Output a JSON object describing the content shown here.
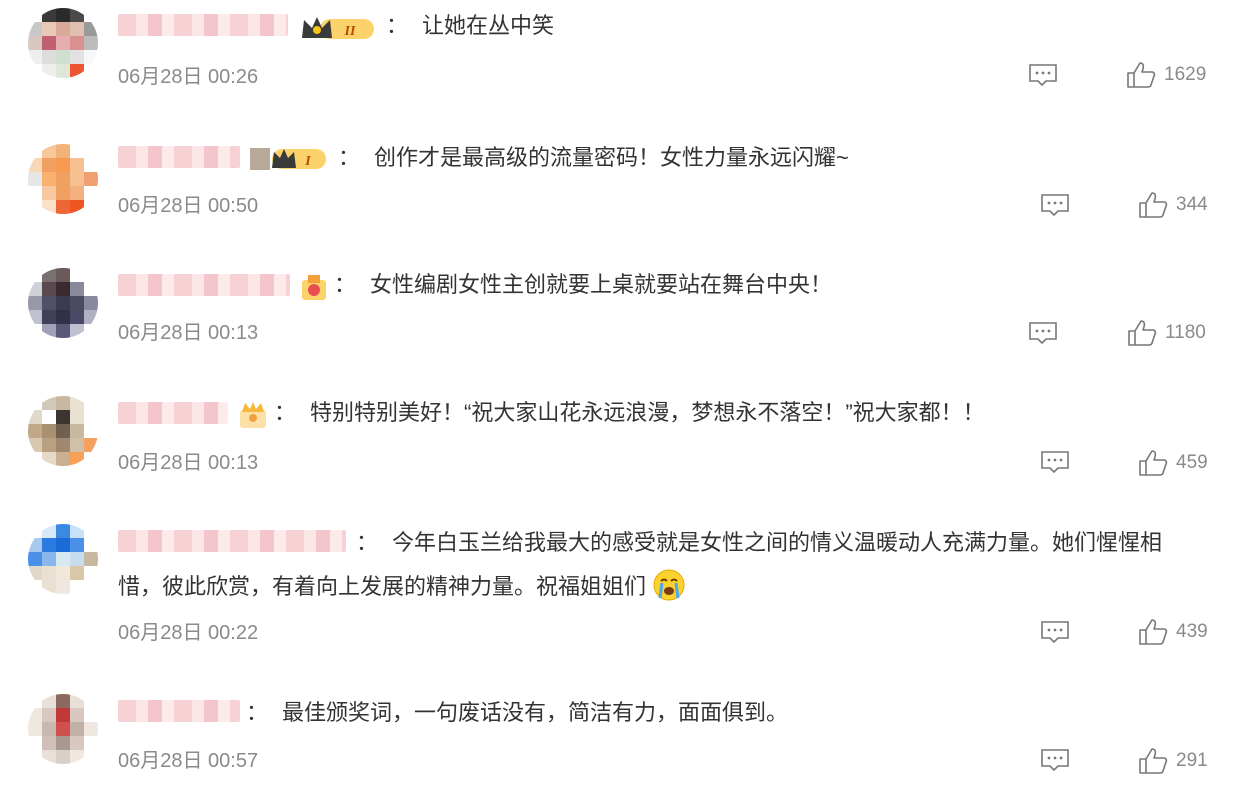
{
  "comments": [
    {
      "colon": "：",
      "text": "让她在丛中笑",
      "time": "06月28日 00:26",
      "likes": "1629"
    },
    {
      "colon": "：",
      "text": "创作才是最高级的流量密码！女性力量永远闪耀~",
      "time": "06月28日 00:50",
      "likes": "344"
    },
    {
      "colon": "：",
      "text": "女性编剧女性主创就要上桌就要站在舞台中央！",
      "time": "06月28日 00:13",
      "likes": "1180"
    },
    {
      "colon": "：",
      "text": "特别特别美好！“祝大家山花永远浪漫，梦想永不落空！”祝大家都！！",
      "time": "06月28日 00:13",
      "likes": "459"
    },
    {
      "colon": "：",
      "text_line1": "今年白玉兰给我最大的感受就是女性之间的情义温暖动人充满力量。她们惺惺相",
      "text_line2": "惜，彼此欣赏，有着向上发展的精神力量。祝福姐姐们",
      "time": "06月28日 00:22",
      "likes": "439"
    },
    {
      "colon": "：",
      "text": "最佳颁奖词，一句废话没有，简洁有力，面面俱到。",
      "time": "06月28日 00:57",
      "likes": "291"
    }
  ],
  "badges": {
    "level2": "II",
    "level1": "I"
  },
  "icons": {
    "reply": "comment-reply-icon",
    "like": "thumbs-up-icon",
    "crown": "crown-icon",
    "emoji": "crying-emoji-icon"
  },
  "colors": {
    "time": "#8a8a8a",
    "text": "#333333",
    "badge_gold": "#f5a623"
  }
}
